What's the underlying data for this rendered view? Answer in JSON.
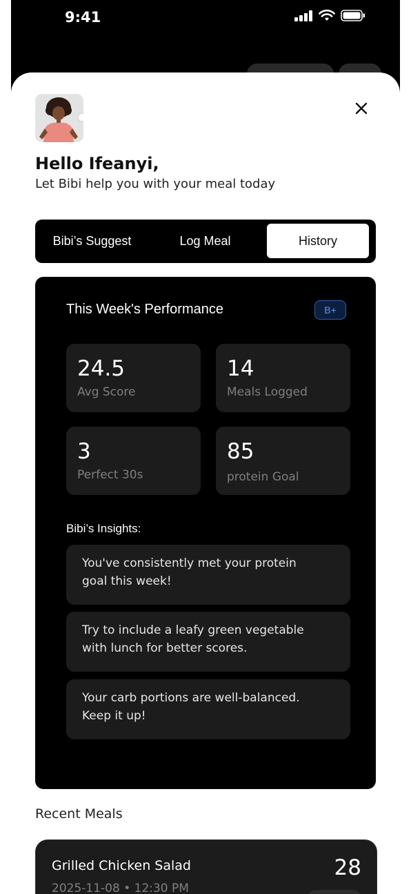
{
  "status_bar": {
    "time": "9:41"
  },
  "header": {
    "greeting": "Hello Ifeanyi,",
    "subtitle": "Let Bibi help you with your meal today"
  },
  "tabs": [
    {
      "label": "Bibi’s Suggest",
      "active": false
    },
    {
      "label": "Log Meal",
      "active": false
    },
    {
      "label": "History",
      "active": true
    }
  ],
  "performance": {
    "title": "This Week's Performance",
    "grade": "B+",
    "stats": [
      {
        "value": "24.5",
        "label": "Avg Score"
      },
      {
        "value": "14",
        "label": "Meals Logged"
      },
      {
        "value": "3",
        "label": "Perfect 30s"
      },
      {
        "value": "85",
        "label": "protein Goal"
      }
    ],
    "insights_title": "Bibi’s Insights:",
    "insights": [
      "You've consistently met your protein goal this week!",
      "Try to include a leafy green vegetable with lunch for better scores.",
      "Your carb portions are well-balanced. Keep it up!"
    ]
  },
  "recent_meals": {
    "title": "Recent Meals",
    "items": [
      {
        "name": "Grilled Chicken Salad",
        "datetime": "2025-11-08 • 12:30 PM",
        "score": "28"
      }
    ]
  },
  "icons": [
    "signal-icon",
    "wifi-icon",
    "battery-icon",
    "close-icon",
    "avatar"
  ],
  "colors": {
    "background": "#000000",
    "sheet": "#ffffff",
    "card": "#1c1c1c",
    "badge": "#5f95f0"
  }
}
